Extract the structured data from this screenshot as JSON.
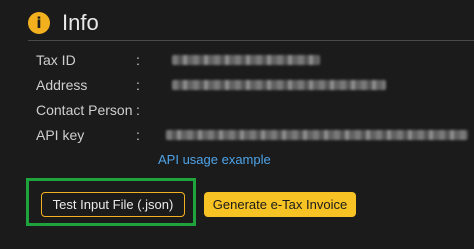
{
  "header": {
    "icon": "info-icon",
    "icon_glyph": "i",
    "title": "Info",
    "accent_color": "#f2b01e"
  },
  "fields": [
    {
      "label": "Tax ID",
      "colon": ":",
      "redacted": true
    },
    {
      "label": "Address",
      "colon": ":",
      "redacted": true
    },
    {
      "label": "Contact Person",
      "colon": ":",
      "redacted": false
    },
    {
      "label": "API key",
      "colon": ":",
      "redacted": true
    }
  ],
  "links": {
    "api_usage": "API usage example"
  },
  "buttons": {
    "test_input": "Test Input File (.json)",
    "generate": "Generate e-Tax Invoice"
  },
  "colors": {
    "background": "#1b1b1b",
    "link": "#4ea3e8",
    "primary_button": "#f7c224",
    "highlight_box": "#1fa33c"
  }
}
